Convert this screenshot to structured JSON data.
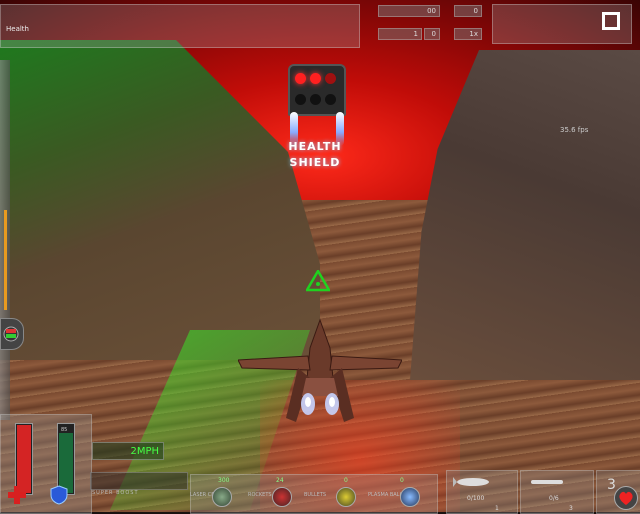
{
  "hud": {
    "health_label": "Health",
    "score_value": "00",
    "kills_value": "0",
    "time_value": "1",
    "time_value2": "0",
    "multi_value": "1x",
    "fps_text": "35.6 fps",
    "colors": {
      "health_bar": "#d42424",
      "shield_bar": "#1a6a3a",
      "speed_text": "#44ff44",
      "accent": "#ffffff"
    }
  },
  "goal": {
    "label_health": "HEALTH",
    "label_shield": "SHIELD"
  },
  "bottom": {
    "speed_text": "2MPH",
    "super_boost_label": "SUPER BOOST",
    "shield_number": "85",
    "weapons": [
      {
        "label": "LASER CELLS",
        "count": "300",
        "icon": "laser-icon"
      },
      {
        "label": "ROCKETS",
        "count": "24",
        "icon": "rocket-icon"
      },
      {
        "label": "BULLETS",
        "count": "0",
        "icon": "bullet-icon"
      },
      {
        "label": "PLASMA BALLS",
        "count": "0",
        "icon": "plasma-icon"
      }
    ],
    "secondary": [
      {
        "value": "0/100",
        "icon": "missile-icon"
      },
      {
        "value": "0/6",
        "icon": "torpedo-icon"
      },
      {
        "value": "3",
        "icon": "special-icon"
      }
    ],
    "secondary_sub": [
      "1",
      "3"
    ]
  }
}
